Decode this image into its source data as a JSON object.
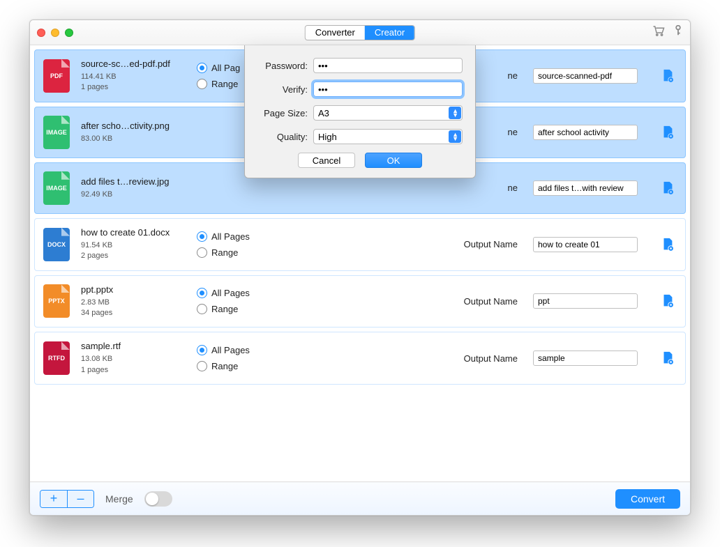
{
  "titlebar": {
    "tabs": {
      "converter": "Converter",
      "creator": "Creator"
    }
  },
  "dialog": {
    "labels": {
      "password": "Password:",
      "verify": "Verify:",
      "page_size": "Page Size:",
      "quality": "Quality:"
    },
    "values": {
      "password": "•••",
      "verify": "•••",
      "page_size": "A3",
      "quality": "High"
    },
    "buttons": {
      "cancel": "Cancel",
      "ok": "OK"
    }
  },
  "page_opts": {
    "all": "All Pages",
    "range": "Range",
    "all_truncated": "All Pag"
  },
  "output_label": "Output Name",
  "output_label_trunc": "ne",
  "files": [
    {
      "type": "PDF",
      "name": "source-sc…ed-pdf.pdf",
      "size": "114.41 KB",
      "pages": "1 pages",
      "output": "source-scanned-pdf",
      "selected": true
    },
    {
      "type": "IMAGE",
      "name": "after scho…ctivity.png",
      "size": "83.00 KB",
      "pages": "",
      "output": "after school activity",
      "selected": true
    },
    {
      "type": "IMAGE",
      "name": "add files t…review.jpg",
      "size": "92.49 KB",
      "pages": "",
      "output": "add files t…with review",
      "selected": true
    },
    {
      "type": "DOCX",
      "name": "how to create 01.docx",
      "size": "91.54 KB",
      "pages": "2 pages",
      "output": "how to create 01",
      "selected": false
    },
    {
      "type": "PPTX",
      "name": "ppt.pptx",
      "size": "2.83 MB",
      "pages": "34 pages",
      "output": "ppt",
      "selected": false
    },
    {
      "type": "RTFD",
      "name": "sample.rtf",
      "size": "13.08 KB",
      "pages": "1 pages",
      "output": "sample",
      "selected": false
    }
  ],
  "footer": {
    "merge": "Merge",
    "convert": "Convert",
    "add": "+",
    "remove": "–"
  }
}
